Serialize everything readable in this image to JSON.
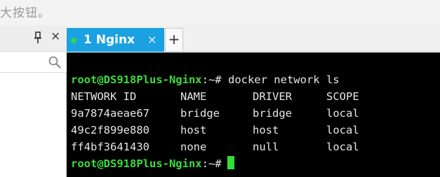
{
  "hint": {
    "text": "大按钮。"
  },
  "left_panel": {
    "close_label": "×"
  },
  "tabs": [
    {
      "label": "1 Nginx",
      "close_label": "×",
      "active": true,
      "status_color": "#39d353"
    }
  ],
  "tab_add_label": "+",
  "terminal": {
    "prompt_user": "root@DS918Plus-Nginx",
    "prompt_path": ":~#",
    "command": "docker network ls",
    "headers": [
      "NETWORK ID",
      "NAME",
      "DRIVER",
      "SCOPE"
    ],
    "rows": [
      [
        "9a7874aeae67",
        "bridge",
        "bridge",
        "local"
      ],
      [
        "49c2f899e880",
        "host",
        "host",
        "local"
      ],
      [
        "ff4bf3641430",
        "none",
        "null",
        "local"
      ]
    ]
  },
  "colors": {
    "accent": "#1ba1e2",
    "prompt": "#3ddc3d",
    "terminal_bg": "#000000"
  }
}
